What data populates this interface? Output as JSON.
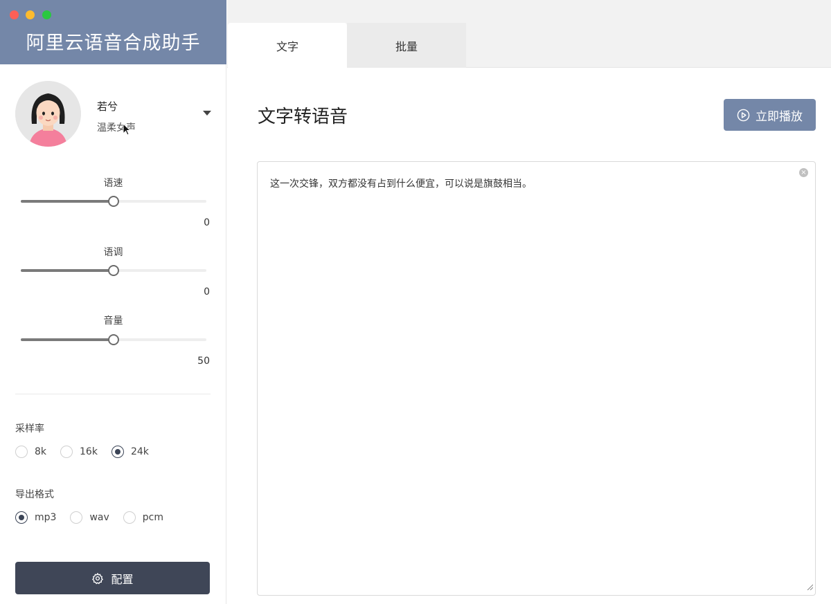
{
  "app": {
    "title": "阿里云语音合成助手"
  },
  "voice": {
    "name": "若兮",
    "description": "温柔女声"
  },
  "sliders": [
    {
      "label": "语速",
      "value": "0",
      "level": 0.5
    },
    {
      "label": "语调",
      "value": "0",
      "level": 0.5
    },
    {
      "label": "音量",
      "value": "50",
      "level": 0.5
    }
  ],
  "sample_rate": {
    "label": "采样率",
    "options": [
      "8k",
      "16k",
      "24k"
    ],
    "selected": "24k"
  },
  "export_format": {
    "label": "导出格式",
    "options": [
      "mp3",
      "wav",
      "pcm"
    ],
    "selected": "mp3"
  },
  "config_button": {
    "label": "配置",
    "icon": "gear-icon"
  },
  "tabs": [
    {
      "label": "文字",
      "active": true
    },
    {
      "label": "批量",
      "active": false
    }
  ],
  "main": {
    "title": "文字转语音",
    "play_button": {
      "label": "立即播放",
      "icon": "play-circle-icon"
    },
    "text_input": {
      "value": "这一次交锋，双方都没有占到什么便宜，可以说是旗鼓相当。"
    }
  },
  "colors": {
    "header_bg": "#7487a8",
    "primary_button": "#7487a8",
    "config_button": "#3f4657",
    "radio_checked": "#3b4456"
  }
}
